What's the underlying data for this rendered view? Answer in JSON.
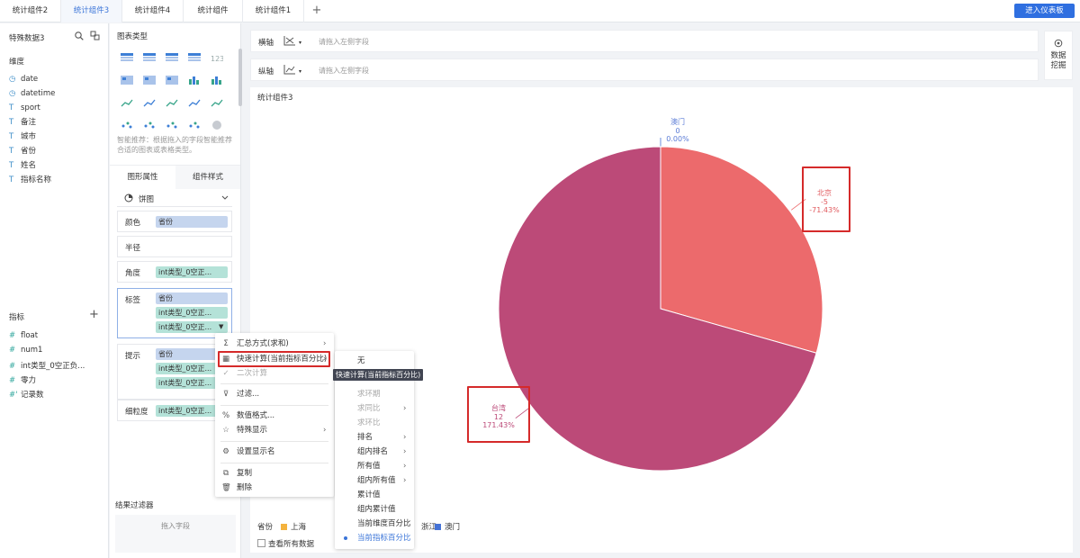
{
  "tabs": [
    {
      "label": "统计组件2"
    },
    {
      "label": "统计组件3"
    },
    {
      "label": "统计组件4"
    },
    {
      "label": "统计组件"
    },
    {
      "label": "统计组件1"
    }
  ],
  "tab_add_label": "+",
  "enter_dashboard_label": "进入仪表板",
  "left_panel": {
    "dataset_name": "特殊数据3",
    "dimension_title": "维度",
    "dimensions": [
      {
        "icon": "clock-icon",
        "glyph": "◷",
        "label": "date"
      },
      {
        "icon": "clock-icon",
        "glyph": "◷",
        "label": "datetime"
      },
      {
        "icon": "text-type-icon",
        "glyph": "T",
        "label": "sport"
      },
      {
        "icon": "text-type-icon",
        "glyph": "T",
        "label": "备注"
      },
      {
        "icon": "text-type-icon",
        "glyph": "T",
        "label": "城市"
      },
      {
        "icon": "text-type-icon",
        "glyph": "T",
        "label": "省份"
      },
      {
        "icon": "text-type-icon",
        "glyph": "T",
        "label": "姓名"
      },
      {
        "icon": "text-type-icon",
        "glyph": "T",
        "label": "指标名称"
      }
    ],
    "measure_title": "指标",
    "measure_add": "+",
    "measures": [
      {
        "icon": "number-type-icon",
        "glyph": "#",
        "label": "float"
      },
      {
        "icon": "number-type-icon",
        "glyph": "#",
        "label": "num1"
      },
      {
        "icon": "number-type-icon",
        "glyph": "#",
        "label": "int类型_0空正负..."
      },
      {
        "icon": "number-type-icon",
        "glyph": "#",
        "label": "零力"
      },
      {
        "icon": "record-count-icon",
        "glyph": "#'",
        "label": "记录数"
      }
    ]
  },
  "mid_panel": {
    "chart_type_title": "图表类型",
    "smart_hint": "智能推荐：根据拖入的字段智能推荐合适的图表或表格类型。",
    "tab_shape_attr": "图形属性",
    "tab_component_style": "组件样式",
    "chart_select_value": "饼图",
    "rows": {
      "color_label": "颜色",
      "color_pill": "省份",
      "radius_label": "半径",
      "angle_label": "角度",
      "angle_pill": "int类型_0空正...",
      "label_label": "标签",
      "label_pills": [
        "省份",
        "int类型_0空正...",
        "int类型_0空正..."
      ],
      "tooltip_label": "提示",
      "tooltip_pills": [
        "省份",
        "int类型_0空正...",
        "int类型_0空正..."
      ],
      "granularity_label": "细粒度",
      "granularity_pill": "int类型_0空正..."
    },
    "result_filter_title": "结果过滤器",
    "drop_field_placeholder": "拖入字段"
  },
  "context_menu": {
    "items": [
      {
        "icon": "sum-icon",
        "glyph": "Σ",
        "label": "汇总方式(求和)",
        "arrow": "›",
        "disabled": false
      },
      {
        "icon": "quick-calc-icon",
        "glyph": "▦",
        "label": "快速计算(当前指标百分比)",
        "arrow": "›",
        "disabled": false
      },
      {
        "icon": "check-icon",
        "glyph": "✓",
        "label": "二次计算",
        "arrow": "",
        "disabled": true
      },
      {
        "icon": "filter-icon",
        "glyph": "⊽",
        "label": "过滤...",
        "arrow": "",
        "disabled": false
      },
      {
        "icon": "number-format-icon",
        "glyph": "%",
        "label": "数值格式...",
        "arrow": "",
        "disabled": false
      },
      {
        "icon": "star-icon",
        "glyph": "☆",
        "label": "特殊显示",
        "arrow": "›",
        "disabled": false
      },
      {
        "icon": "settings-icon",
        "glyph": "⚙",
        "label": "设置显示名",
        "arrow": "",
        "disabled": false
      },
      {
        "icon": "copy-icon",
        "glyph": "⧉",
        "label": "复制",
        "arrow": "",
        "disabled": false
      },
      {
        "icon": "delete-icon",
        "glyph": "🗑",
        "label": "删除",
        "arrow": "",
        "disabled": false
      }
    ],
    "tooltip": "快速计算(当前指标百分比)"
  },
  "quick_calc_submenu": {
    "items": [
      {
        "label": "无",
        "arrow": "",
        "disabled": false,
        "selected": false
      },
      {
        "label": "求环期",
        "arrow": "",
        "disabled": true,
        "selected": false
      },
      {
        "label": "求同比",
        "arrow": "›",
        "disabled": true,
        "selected": false
      },
      {
        "label": "求环比",
        "arrow": "",
        "disabled": true,
        "selected": false
      },
      {
        "label": "排名",
        "arrow": "›",
        "disabled": false,
        "selected": false
      },
      {
        "label": "组内排名",
        "arrow": "›",
        "disabled": false,
        "selected": false
      },
      {
        "label": "所有值",
        "arrow": "›",
        "disabled": false,
        "selected": false
      },
      {
        "label": "组内所有值",
        "arrow": "›",
        "disabled": false,
        "selected": false
      },
      {
        "label": "累计值",
        "arrow": "",
        "disabled": false,
        "selected": false
      },
      {
        "label": "组内累计值",
        "arrow": "",
        "disabled": false,
        "selected": false
      },
      {
        "label": "当前维度百分比",
        "arrow": "",
        "disabled": false,
        "selected": false
      },
      {
        "label": "当前指标百分比",
        "arrow": "",
        "disabled": false,
        "selected": true
      }
    ]
  },
  "axes": {
    "x_label": "横轴",
    "y_label": "纵轴",
    "placeholder": "请拖入左侧字段"
  },
  "data_mining_label": "数据挖掘",
  "chart_title": "统计组件3",
  "legend_title": "省份",
  "show_all_data_label": "查看所有数据",
  "chart_data": {
    "type": "pie",
    "slices": [
      {
        "name": "澳门",
        "value": 0,
        "percent": "0.00%",
        "color": "#4472d6"
      },
      {
        "name": "北京",
        "value": -5,
        "percent": "-71.43%",
        "color": "#ec6a6c"
      },
      {
        "name": "台湾",
        "value": 12,
        "percent": "171.43%",
        "color": "#bc4a78"
      }
    ],
    "slice_value_labels": {
      "澳门": "0",
      "北京": "-5",
      "台湾": "12"
    },
    "legend": [
      {
        "name": "上海",
        "color": "#f4b33e"
      },
      {
        "name": "浙江",
        "color": "#3aa0b8"
      },
      {
        "name": "澳门",
        "color": "#4472d6"
      }
    ],
    "legend_partial": [
      "上海",
      "北",
      "浙江",
      "澳门"
    ]
  }
}
